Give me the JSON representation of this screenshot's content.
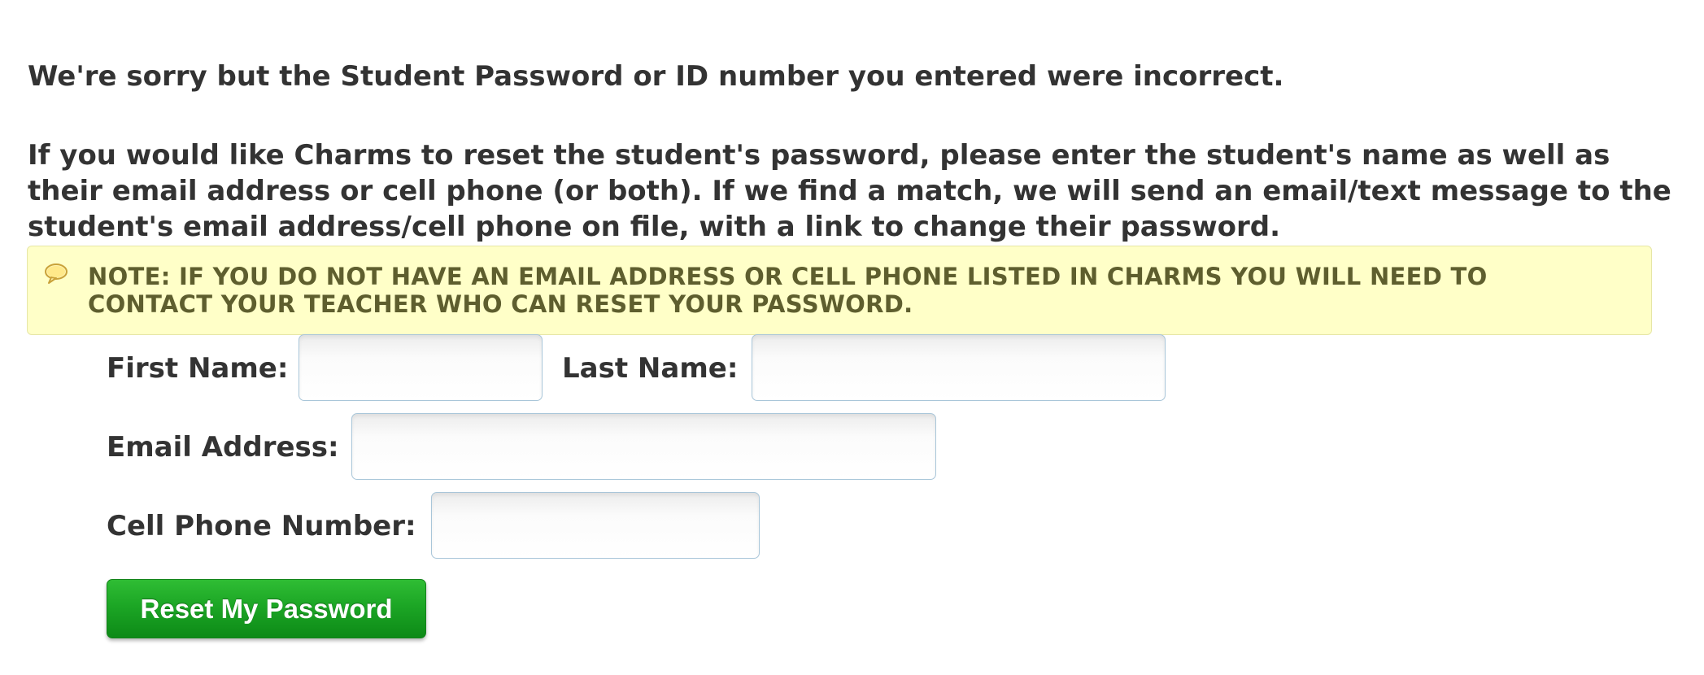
{
  "messages": {
    "error": "We're sorry but the Student Password or ID number you entered were incorrect.",
    "instructions": "If you would like Charms to reset the student's password, please enter the student's name as well as their email address or cell phone (or both). If we find a match, we will send an email/text message to the student's email address/cell phone on file, with a link to change their password."
  },
  "note": {
    "icon": "speech-bubble-icon",
    "text": "NOTE: IF YOU DO NOT HAVE AN EMAIL ADDRESS OR CELL PHONE LISTED IN CHARMS YOU WILL NEED TO CONTACT YOUR TEACHER WHO CAN RESET YOUR PASSWORD.",
    "background_color": "#ffffc8"
  },
  "form": {
    "first_name": {
      "label": "First Name:",
      "value": "",
      "placeholder": ""
    },
    "last_name": {
      "label": "Last Name:",
      "value": "",
      "placeholder": ""
    },
    "email": {
      "label": "Email Address:",
      "value": "",
      "placeholder": ""
    },
    "cell_phone": {
      "label": "Cell Phone Number:",
      "value": "",
      "placeholder": ""
    },
    "submit_label": "Reset My Password"
  },
  "colors": {
    "text": "#333333",
    "note_text": "#5e5e2e",
    "button_green": "#1ca625",
    "input_border": "#a9c6d9"
  }
}
